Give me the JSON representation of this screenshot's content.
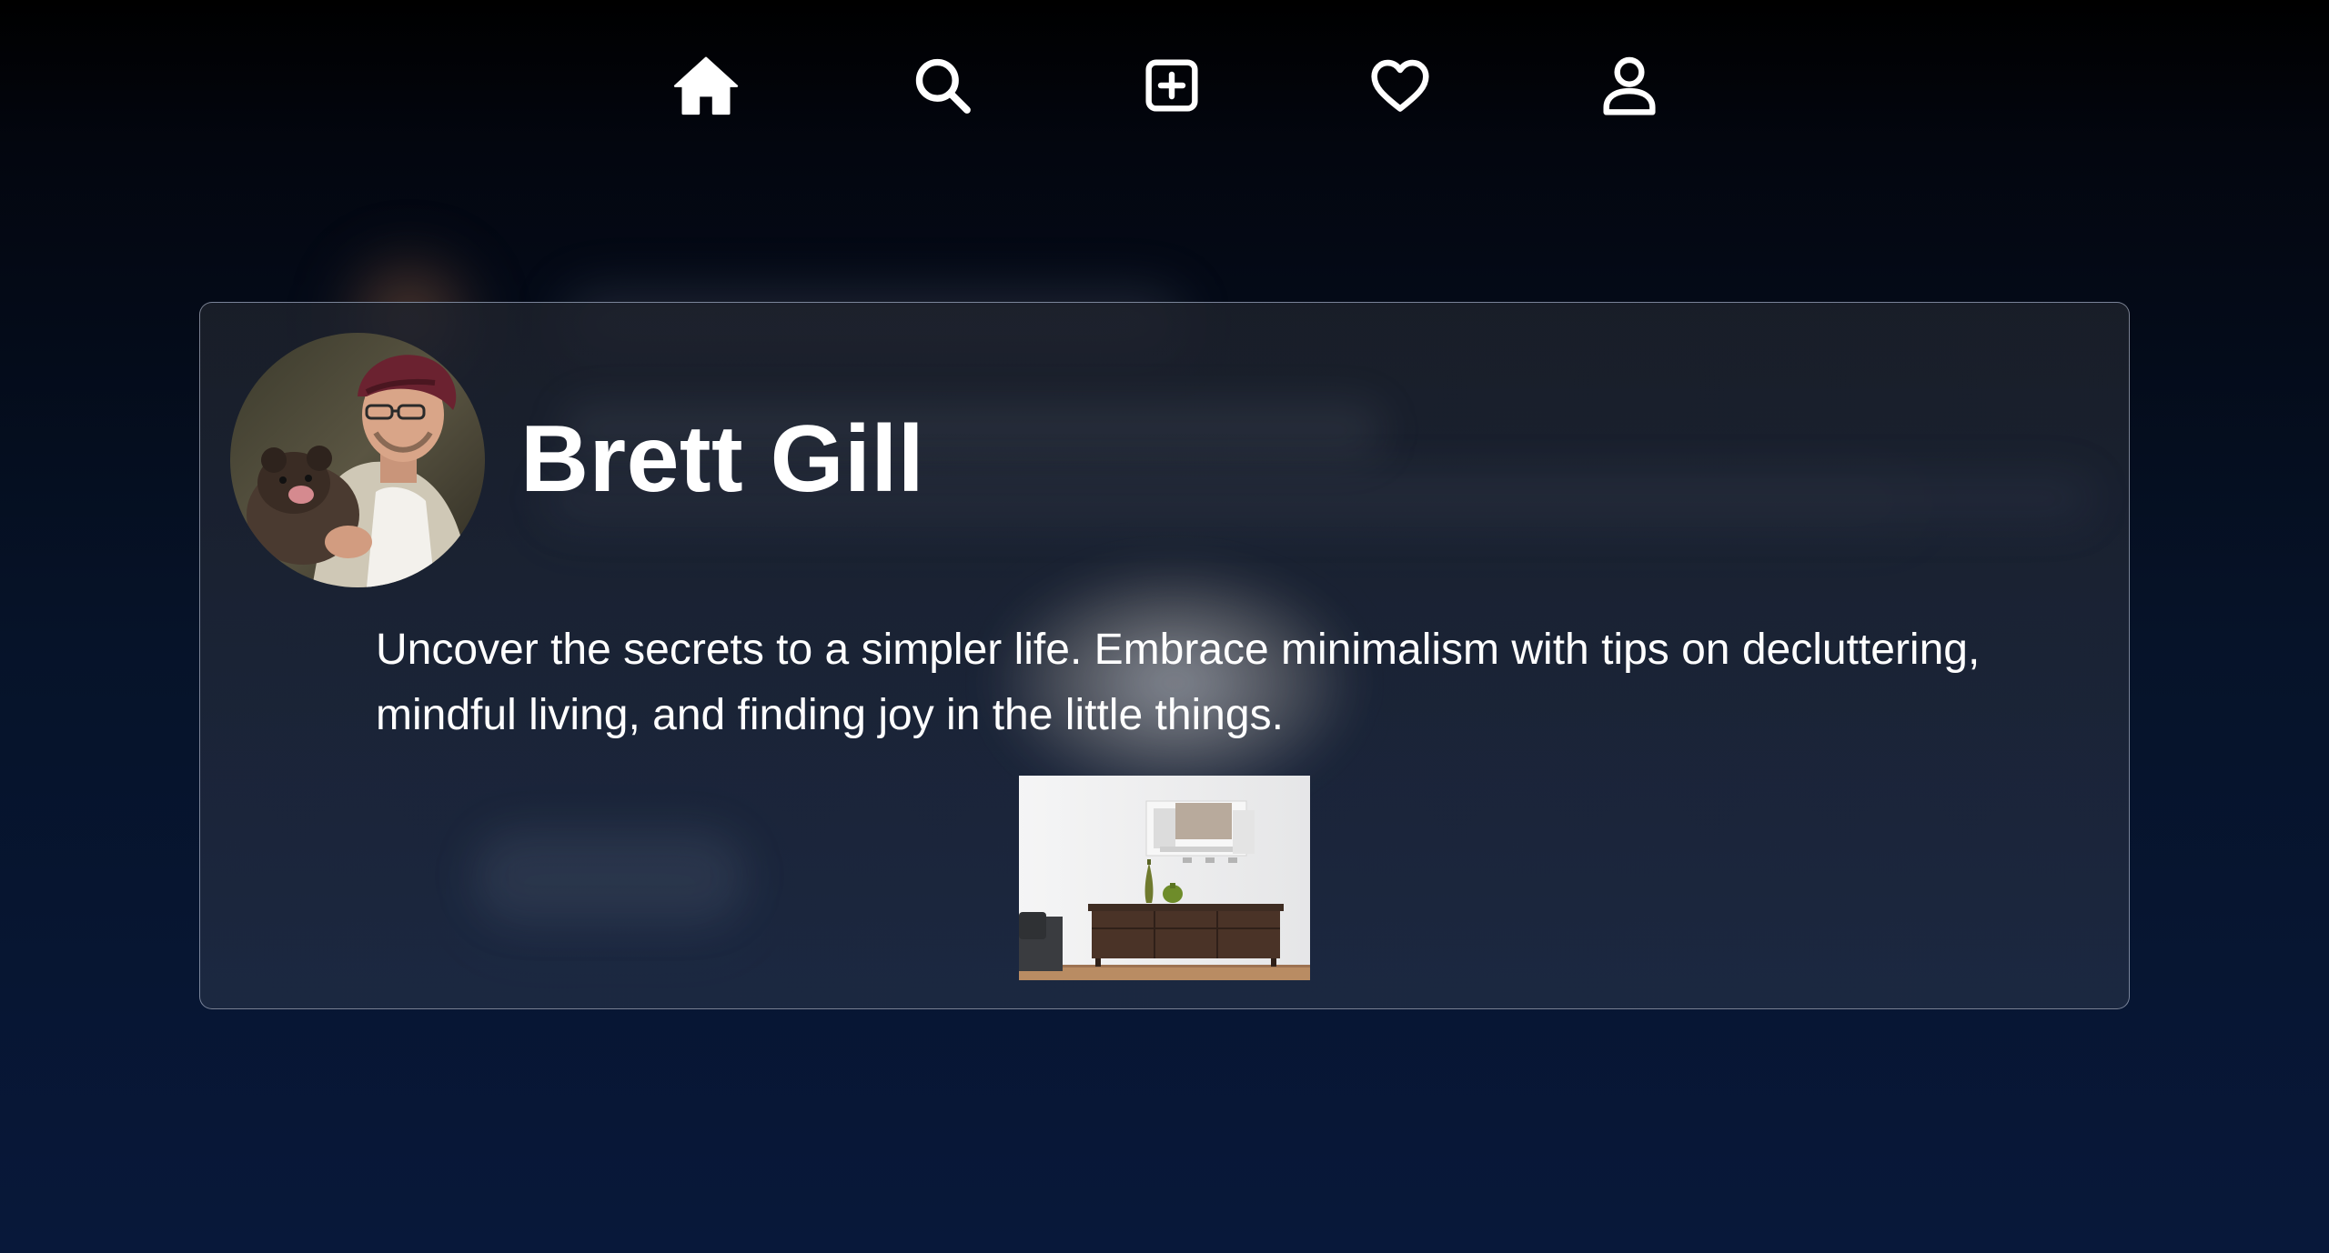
{
  "nav": {
    "items": [
      {
        "name": "home",
        "icon": "home-icon"
      },
      {
        "name": "search",
        "icon": "search-icon"
      },
      {
        "name": "create",
        "icon": "plus-square-icon"
      },
      {
        "name": "likes",
        "icon": "heart-icon"
      },
      {
        "name": "profile",
        "icon": "user-icon"
      }
    ]
  },
  "post": {
    "author": "Brett Gill",
    "text": "Uncover the secrets to a simpler life. Embrace minimalism with tips on decluttering, mindful living, and finding joy in the little things.",
    "avatar": "avatar-man-with-dog",
    "image": "minimalist-interior-photo"
  },
  "colors": {
    "background_top": "#000000",
    "background_bottom": "#08183a",
    "card_border": "#c8d2e6",
    "text": "#ffffff"
  }
}
